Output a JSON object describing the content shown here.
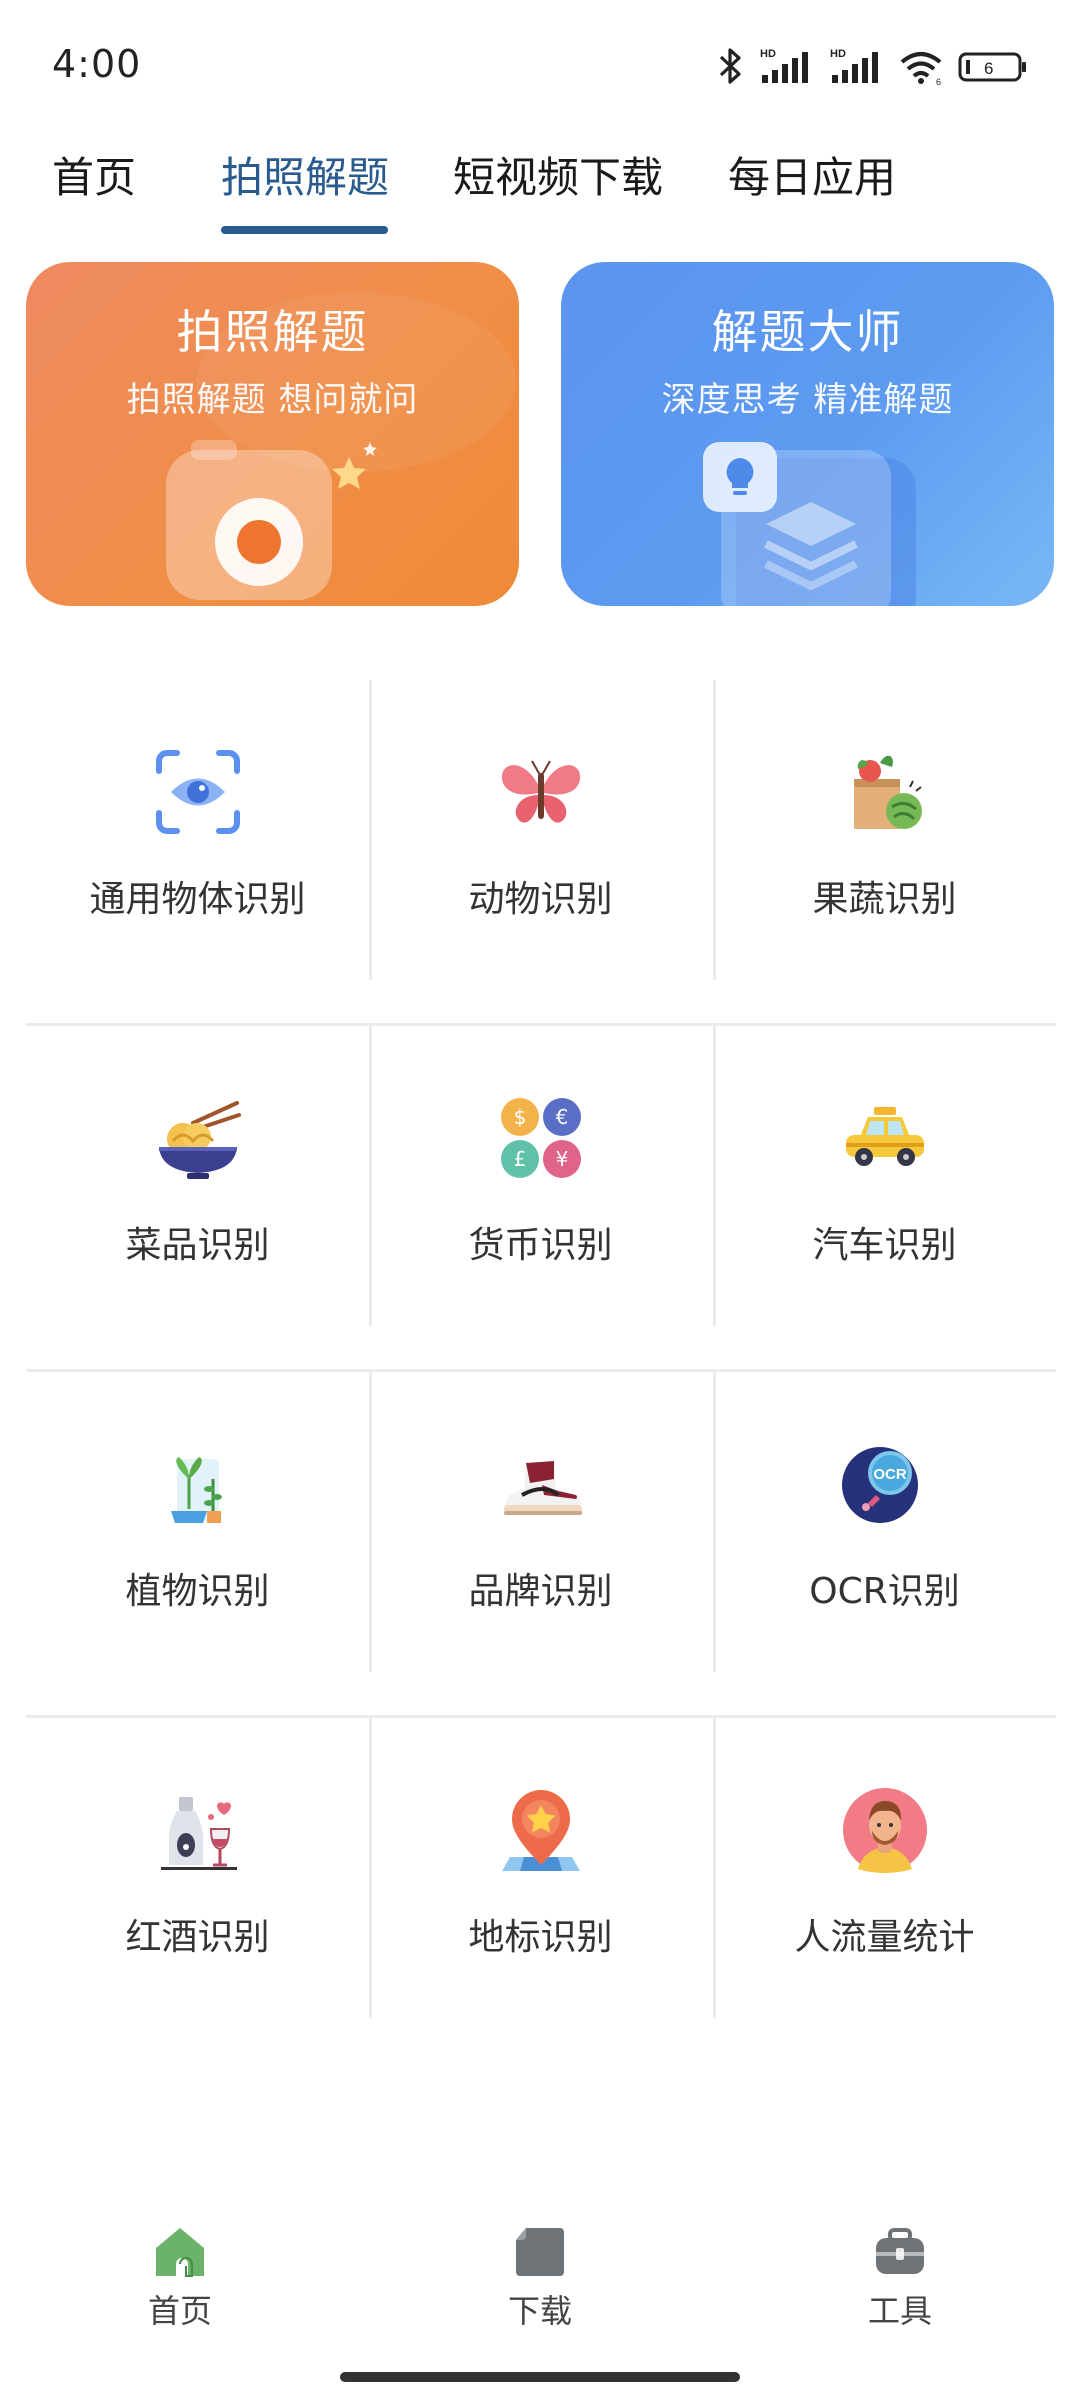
{
  "status_bar": {
    "time": "4:00",
    "battery": "6",
    "icons": [
      "bluetooth-icon",
      "hd-signal-icon",
      "hd-signal-icon",
      "wifi-icon",
      "battery-icon"
    ]
  },
  "top_tabs": [
    {
      "label": "首页",
      "active": false
    },
    {
      "label": "拍照解题",
      "active": true
    },
    {
      "label": "短视频下载",
      "active": false
    },
    {
      "label": "每日应用",
      "active": false
    }
  ],
  "colors": {
    "accent": "#2a5b8f",
    "banner_orange": "#f08e48",
    "banner_blue": "#5c9bf0",
    "nav_home": "#6bb36a",
    "nav_inactive": "#6e7378"
  },
  "banners": [
    {
      "title": "拍照解题",
      "subtitle": "拍照解题  想问就问",
      "icon": "camera-icon"
    },
    {
      "title": "解题大师",
      "subtitle": "深度思考  精准解题",
      "icon": "lightbulb-icon"
    }
  ],
  "grid": [
    [
      {
        "label": "通用物体识别",
        "icon": "scan-eye-icon"
      },
      {
        "label": "动物识别",
        "icon": "butterfly-icon"
      },
      {
        "label": "果蔬识别",
        "icon": "vegetable-bag-icon"
      }
    ],
    [
      {
        "label": "菜品识别",
        "icon": "noodle-bowl-icon"
      },
      {
        "label": "货币识别",
        "icon": "coins-icon"
      },
      {
        "label": "汽车识别",
        "icon": "taxi-icon"
      }
    ],
    [
      {
        "label": "植物识别",
        "icon": "plant-icon"
      },
      {
        "label": "品牌识别",
        "icon": "sneaker-icon"
      },
      {
        "label": "OCR识别",
        "icon": "ocr-icon"
      }
    ],
    [
      {
        "label": "红酒识别",
        "icon": "wine-icon"
      },
      {
        "label": "地标识别",
        "icon": "landmark-pin-icon"
      },
      {
        "label": "人流量统计",
        "icon": "person-avatar-icon"
      }
    ]
  ],
  "bottom_nav": [
    {
      "label": "首页",
      "icon": "home-icon",
      "active": true
    },
    {
      "label": "下载",
      "icon": "download-folder-icon",
      "active": false
    },
    {
      "label": "工具",
      "icon": "toolbox-icon",
      "active": false
    }
  ]
}
